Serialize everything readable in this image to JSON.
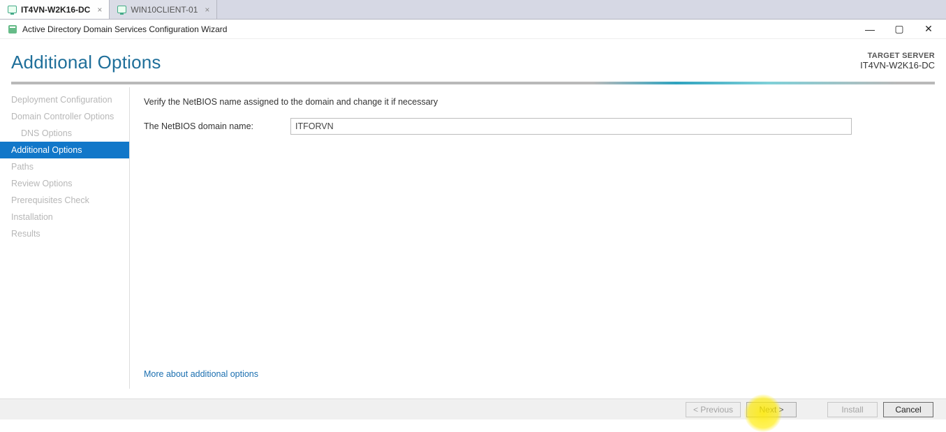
{
  "vm_tabs": [
    {
      "label": "IT4VN-W2K16-DC",
      "active": true
    },
    {
      "label": "WIN10CLIENT-01",
      "active": false
    }
  ],
  "window_title": "Active Directory Domain Services Configuration Wizard",
  "page_title": "Additional Options",
  "target": {
    "label": "TARGET SERVER",
    "name": "IT4VN-W2K16-DC"
  },
  "sidebar": {
    "items": [
      {
        "label": "Deployment Configuration",
        "indent": false
      },
      {
        "label": "Domain Controller Options",
        "indent": false
      },
      {
        "label": "DNS Options",
        "indent": true
      },
      {
        "label": "Additional Options",
        "indent": false,
        "active": true
      },
      {
        "label": "Paths",
        "indent": false
      },
      {
        "label": "Review Options",
        "indent": false
      },
      {
        "label": "Prerequisites Check",
        "indent": false
      },
      {
        "label": "Installation",
        "indent": false
      },
      {
        "label": "Results",
        "indent": false
      }
    ]
  },
  "main": {
    "instruction": "Verify the NetBIOS name assigned to the domain and change it if necessary",
    "field_label": "The NetBIOS domain name:",
    "field_value": "ITFORVN",
    "more_link": "More about additional options"
  },
  "footer": {
    "previous": "< Previous",
    "next": "Next >",
    "install": "Install",
    "cancel": "Cancel"
  }
}
